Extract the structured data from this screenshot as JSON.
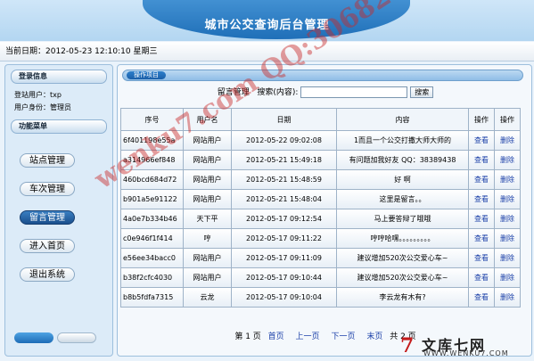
{
  "header": {
    "title": "城市公交查询后台管理"
  },
  "datebar": {
    "text": "当前日期：2012-05-23 12:10:10  星期三"
  },
  "sidebar": {
    "login_heading": "登录信息",
    "user_line": "登站用户：txp",
    "role_line": "用户身份：管理员",
    "menu_heading": "功能菜单",
    "menu": [
      {
        "label": "站点管理"
      },
      {
        "label": "车次管理"
      },
      {
        "label": "留言管理"
      },
      {
        "label": "进入首页"
      },
      {
        "label": "退出系统"
      }
    ]
  },
  "main": {
    "tab_label": "操作项目",
    "search": {
      "title": "留言管理",
      "label": "搜索(内容):",
      "value": "",
      "button": "搜索"
    },
    "columns": [
      "序号",
      "用户名",
      "日期",
      "内容",
      "操作",
      "操作"
    ],
    "rows": [
      {
        "id": "6f401198e55a",
        "user": "网站用户",
        "date": "2012-05-22 09:02:08",
        "content": "1而且一个公交打撒大师大师的",
        "edit": "查看",
        "del": "删除"
      },
      {
        "id": "a314966ef848",
        "user": "网站用户",
        "date": "2012-05-21 15:49:18",
        "content": "有问题加我好友 QQ：38389438",
        "edit": "查看",
        "del": "删除"
      },
      {
        "id": "460bcd684d72",
        "user": "网站用户",
        "date": "2012-05-21 15:48:59",
        "content": "好 啊",
        "edit": "查看",
        "del": "删除"
      },
      {
        "id": "b901a5e91122",
        "user": "网站用户",
        "date": "2012-05-21 15:48:04",
        "content": "这里是留言。。",
        "edit": "查看",
        "del": "删除"
      },
      {
        "id": "4a0e7b334b46",
        "user": "天下平",
        "date": "2012-05-17 09:12:54",
        "content": "马上要答辩了哦哦",
        "edit": "查看",
        "del": "删除"
      },
      {
        "id": "c0e946f1f414",
        "user": "哼",
        "date": "2012-05-17 09:11:22",
        "content": "哼哼哈嘿。。。。。。。。。",
        "edit": "查看",
        "del": "删除"
      },
      {
        "id": "e56ee34bacc0",
        "user": "网站用户",
        "date": "2012-05-17 09:11:09",
        "content": "建议增加520次公交爱心车~",
        "edit": "查看",
        "del": "删除"
      },
      {
        "id": "b38f2cfc4030",
        "user": "网站用户",
        "date": "2012-05-17 09:10:44",
        "content": "建议增加520次公交爱心车~",
        "edit": "查看",
        "del": "删除"
      },
      {
        "id": "b8b5fdfa7315",
        "user": "云龙",
        "date": "2012-05-17 09:10:04",
        "content": "李云龙有木有?",
        "edit": "查看",
        "del": "删除"
      }
    ],
    "pager": {
      "info": "第 1 页",
      "first": "首页",
      "prev": "上一页",
      "next": "下一页",
      "last": "末页",
      "total": "共 2 页"
    }
  },
  "watermark": {
    "text": "wenku7.com  QQ:306826066"
  },
  "logo": {
    "mark": "7",
    "name": "文库七网",
    "url": "WWW.WENKU7.COM"
  }
}
